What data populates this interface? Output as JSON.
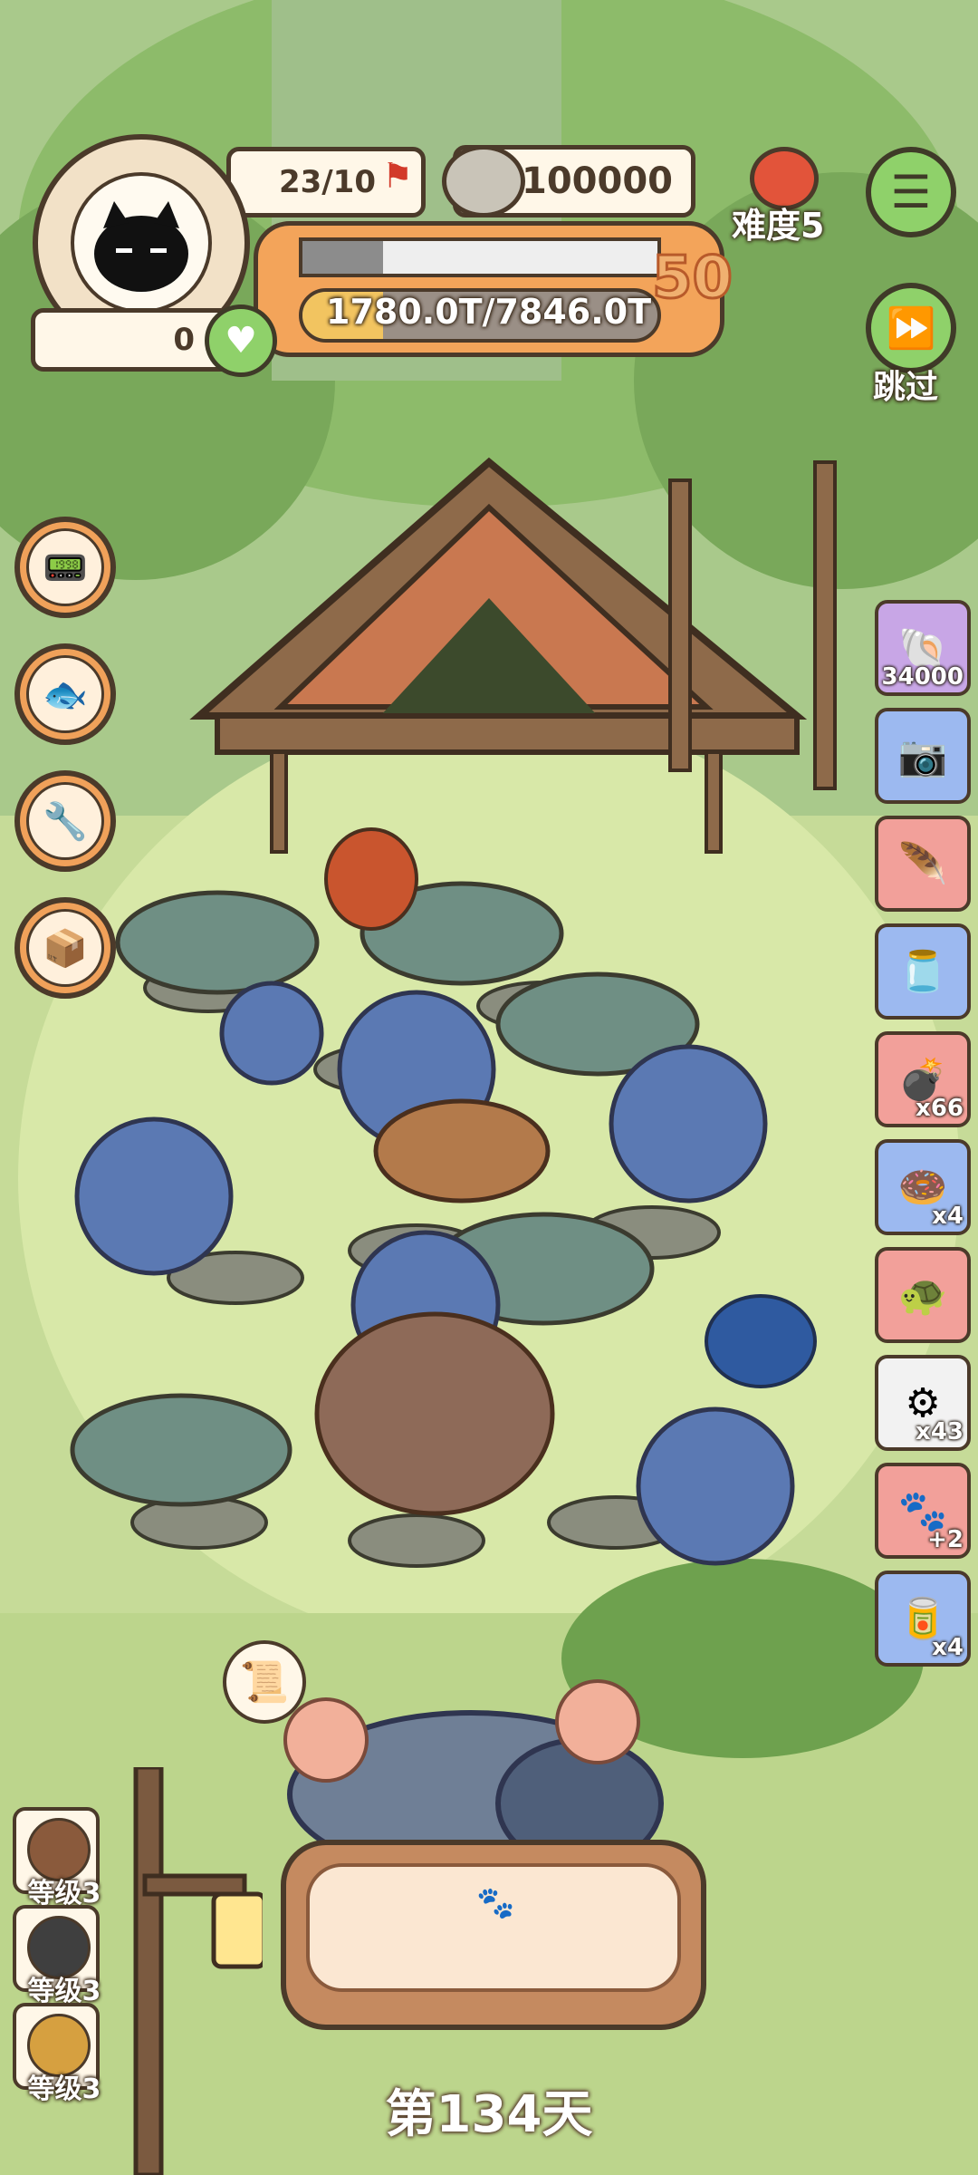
{
  "hud": {
    "flag_count": "23/10",
    "coin_amount": "100000",
    "level_number": "50",
    "progress_text": "1780.0T/7846.0T",
    "progress_fraction": 0.227,
    "heart_amount": "0",
    "difficulty_label": "难度5",
    "skip_label": "跳过"
  },
  "side_items": [
    {
      "icon": "ammonite-icon",
      "bg": "#c8a6e6",
      "count": "34000"
    },
    {
      "icon": "camera-icon",
      "bg": "#9cb9f0",
      "count": ""
    },
    {
      "icon": "feather-icon",
      "bg": "#f2a09a",
      "count": ""
    },
    {
      "icon": "jar-icon",
      "bg": "#9cb9f0",
      "count": ""
    },
    {
      "icon": "bomb-icon",
      "bg": "#f2a09a",
      "count": "x66"
    },
    {
      "icon": "donut-icon",
      "bg": "#9cb9f0",
      "count": "x4"
    },
    {
      "icon": "turtle-shell-icon",
      "bg": "#f2a09a",
      "count": ""
    },
    {
      "icon": "gear-trap-icon",
      "bg": "#f2f2f2",
      "count": "x43"
    },
    {
      "icon": "paw-plus-icon",
      "bg": "#f2a09a",
      "count": "+2"
    },
    {
      "icon": "tin-can-icon",
      "bg": "#9cb9f0",
      "count": "x4"
    }
  ],
  "level_badges": [
    {
      "label": "等级3",
      "icon": "egg-icon"
    },
    {
      "label": "等级3",
      "icon": "dinosaur-head-icon"
    },
    {
      "label": "等级3",
      "icon": "mushroom-icon"
    }
  ],
  "day_label": "第134天"
}
